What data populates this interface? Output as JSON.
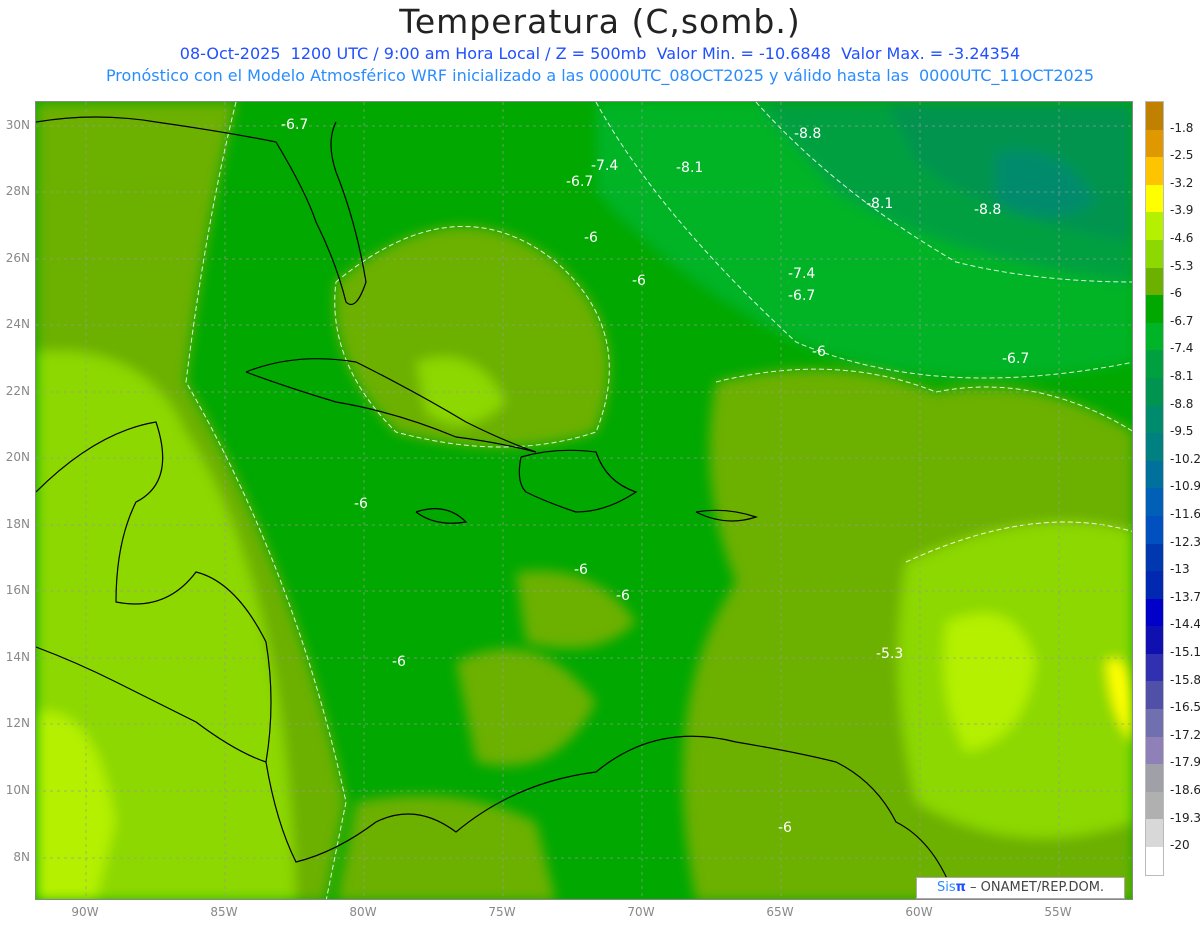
{
  "title": "Temperatura (C,somb.)",
  "subtitle_1": "08-Oct-2025  1200 UTC / 9:00 am Hora Local / Z = 500mb  Valor Min. = -10.6848  Valor Max. = -3.24354",
  "subtitle_2": "Pronóstico con el Modelo Atmosférico WRF inicializado a las 0000UTC_08OCT2025 y válido hasta las  0000UTC_11OCT2025",
  "lat_ticks": [
    "30N",
    "28N",
    "26N",
    "24N",
    "22N",
    "20N",
    "18N",
    "16N",
    "14N",
    "12N",
    "10N",
    "8N"
  ],
  "lon_ticks": [
    "90W",
    "85W",
    "80W",
    "75W",
    "70W",
    "65W",
    "60W",
    "55W"
  ],
  "colorbar": {
    "labels": [
      "-1.8",
      "-2.5",
      "-3.2",
      "-3.9",
      "-4.6",
      "-5.3",
      "-6",
      "-6.7",
      "-7.4",
      "-8.1",
      "-8.8",
      "-9.5",
      "-10.2",
      "-10.9",
      "-11.6",
      "-12.3",
      "-13",
      "-13.7",
      "-14.4",
      "-15.1",
      "-15.8",
      "-16.5",
      "-17.2",
      "-17.9",
      "-18.6",
      "-19.3",
      "-20"
    ],
    "colors": [
      "#c08000",
      "#e09800",
      "#ffc400",
      "#ffff00",
      "#b4f000",
      "#8cd800",
      "#6cb000",
      "#00a800",
      "#00b428",
      "#00a040",
      "#009450",
      "#008c6c",
      "#008080",
      "#00709c",
      "#0060b8",
      "#0050c0",
      "#0038b0",
      "#0028b0",
      "#0000c8",
      "#1010b0",
      "#3030b0",
      "#5050a8",
      "#7070b0",
      "#9080b8",
      "#a0a0a8",
      "#b0b0b0",
      "#d8d8d8",
      "#ffffff"
    ]
  },
  "contour_labels": [
    "-6.7",
    "-8.8",
    "-7.4",
    "-8.1",
    "-6.7",
    "-8.1",
    "-8.8",
    "-6",
    "-6",
    "-7.4",
    "-6.7",
    "-6",
    "-6.7",
    "-6",
    "-6",
    "-6",
    "-6",
    "-5.3",
    "-6"
  ],
  "logo": {
    "brand_a": "Sis",
    "brand_b": "π",
    "text": " – ONAMET/REP.DOM."
  }
}
